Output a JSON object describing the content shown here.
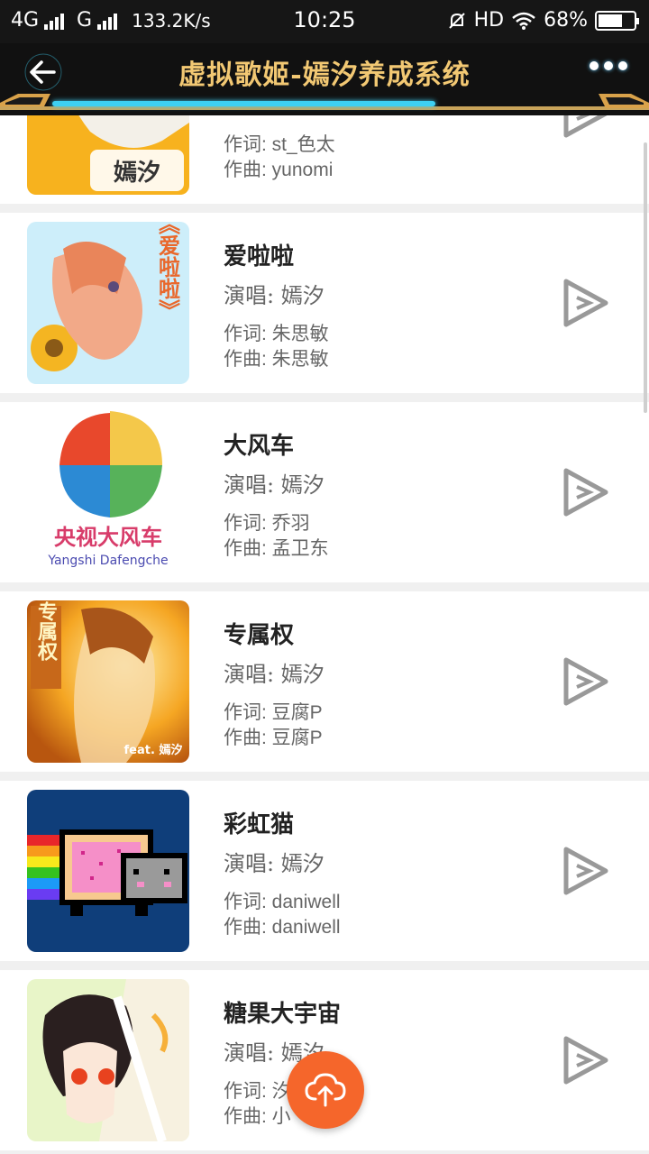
{
  "status_bar": {
    "network1": "4G",
    "network2": "G",
    "speed": "133.2K/s",
    "time": "10:25",
    "hd": "HD",
    "battery": "68%",
    "battery_level": 0.68
  },
  "header": {
    "title": "虚拟歌姬-嫣汐养成系统",
    "progress": 0.59
  },
  "songs": [
    {
      "title": "",
      "singer": "",
      "lyricist": "作词: st_色太",
      "composer": "作曲: yunomi",
      "cover_text": "嫣汐"
    },
    {
      "title": "爱啦啦",
      "singer": "演唱: 嫣汐",
      "lyricist": "作词: 朱思敏",
      "composer": "作曲: 朱思敏",
      "cover_text": "《爱啦啦》"
    },
    {
      "title": "大风车",
      "singer": "演唱: 嫣汐",
      "lyricist": "作词: 乔羽",
      "composer": "作曲: 孟卫东",
      "cover_text": "央视大风车",
      "cover_sub": "Yangshi Dafengche"
    },
    {
      "title": "专属权",
      "singer": "演唱: 嫣汐",
      "lyricist": "作词: 豆腐P",
      "composer": "作曲: 豆腐P",
      "cover_text": "专属权",
      "cover_sub": "feat. 嫣汐"
    },
    {
      "title": "彩虹猫",
      "singer": "演唱: 嫣汐",
      "lyricist": "作词: daniwell",
      "composer": "作曲: daniwell",
      "cover_text": ""
    },
    {
      "title": "糖果大宇宙",
      "singer": "演唱: 嫣汐",
      "lyricist": "作词: 汐",
      "composer": "作曲: 小",
      "cover_text": ""
    }
  ],
  "icons": {
    "back": "back-arrow-icon",
    "more": "more-dots-icon",
    "play": "play-triangle-icon",
    "upload": "cloud-upload-icon"
  },
  "colors": {
    "title_gold": "#f2c873",
    "accent_cyan": "#3ed0f2",
    "fab_orange": "#f5662b"
  }
}
